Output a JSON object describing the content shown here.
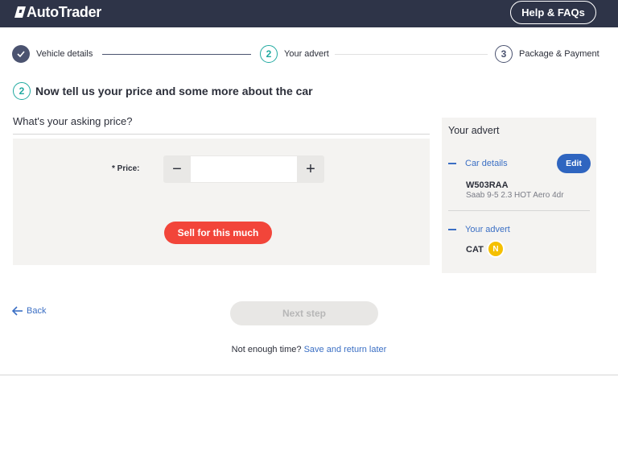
{
  "header": {
    "brand": "AutoTrader",
    "help_label": "Help & FAQs"
  },
  "steps": [
    {
      "number": "",
      "label": "Vehicle details",
      "state": "complete"
    },
    {
      "number": "2",
      "label": "Your advert",
      "state": "current"
    },
    {
      "number": "3",
      "label": "Package & Payment",
      "state": "upcoming"
    }
  ],
  "heading": {
    "number": "2",
    "text": "Now tell us your price and some more about the car"
  },
  "price_section": {
    "title": "What's your asking price?",
    "price_label": "* Price:",
    "price_value": "",
    "decrement": "−",
    "increment": "+",
    "sell_button": "Sell for this much"
  },
  "sidebar": {
    "title": "Your advert",
    "car_details_link": "Car details",
    "edit_label": "Edit",
    "registration": "W503RAA",
    "model": "Saab 9-5 2.3 HOT Aero 4dr",
    "your_advert_link": "Your advert",
    "cat_label": "CAT",
    "cat_value": "N"
  },
  "nav": {
    "back_label": "Back",
    "next_label": "Next step",
    "save_prompt": "Not enough time?",
    "save_link": "Save and return later"
  },
  "colors": {
    "header_bg": "#2e3448",
    "accent_teal": "#1fa9a0",
    "accent_red": "#f2453a",
    "link_blue": "#3b6fc4",
    "badge_yellow": "#f5c000"
  }
}
